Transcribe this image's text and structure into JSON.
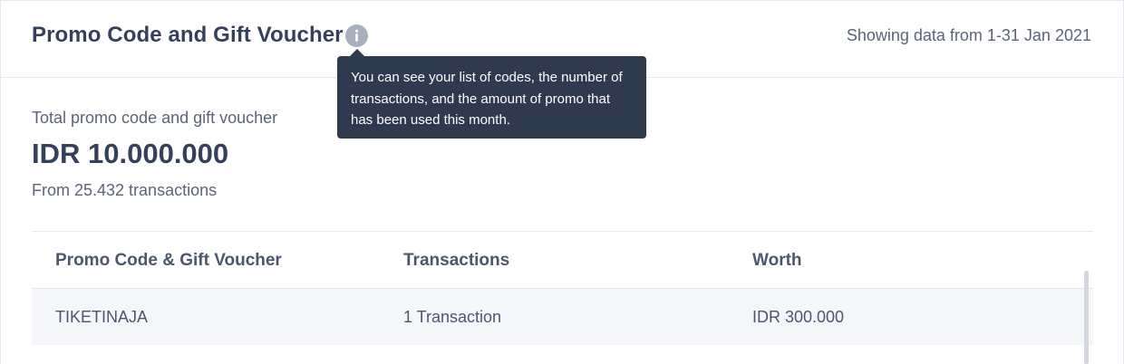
{
  "header": {
    "title": "Promo Code and Gift Voucher",
    "range_text": "Showing data from 1-31 Jan 2021"
  },
  "tooltip": {
    "text": "You can see your list of codes, the number of transactions, and the amount of promo that has been used this month."
  },
  "summary": {
    "label": "Total promo code and gift voucher",
    "value": "IDR 10.000.000",
    "subtext": "From 25.432 transactions"
  },
  "table": {
    "columns": [
      "Promo Code & Gift Voucher",
      "Transactions",
      "Worth"
    ],
    "rows": [
      [
        "TIKETINAJA",
        "1 Transaction",
        "IDR 300.000"
      ]
    ]
  },
  "icons": {
    "info": "info-icon"
  },
  "colors": {
    "text_primary": "#35405a",
    "text_secondary": "#5b6478",
    "tooltip_bg": "#2f3a4e",
    "icon_gray": "#a9b0bd",
    "row_bg": "#f4f6f9"
  }
}
